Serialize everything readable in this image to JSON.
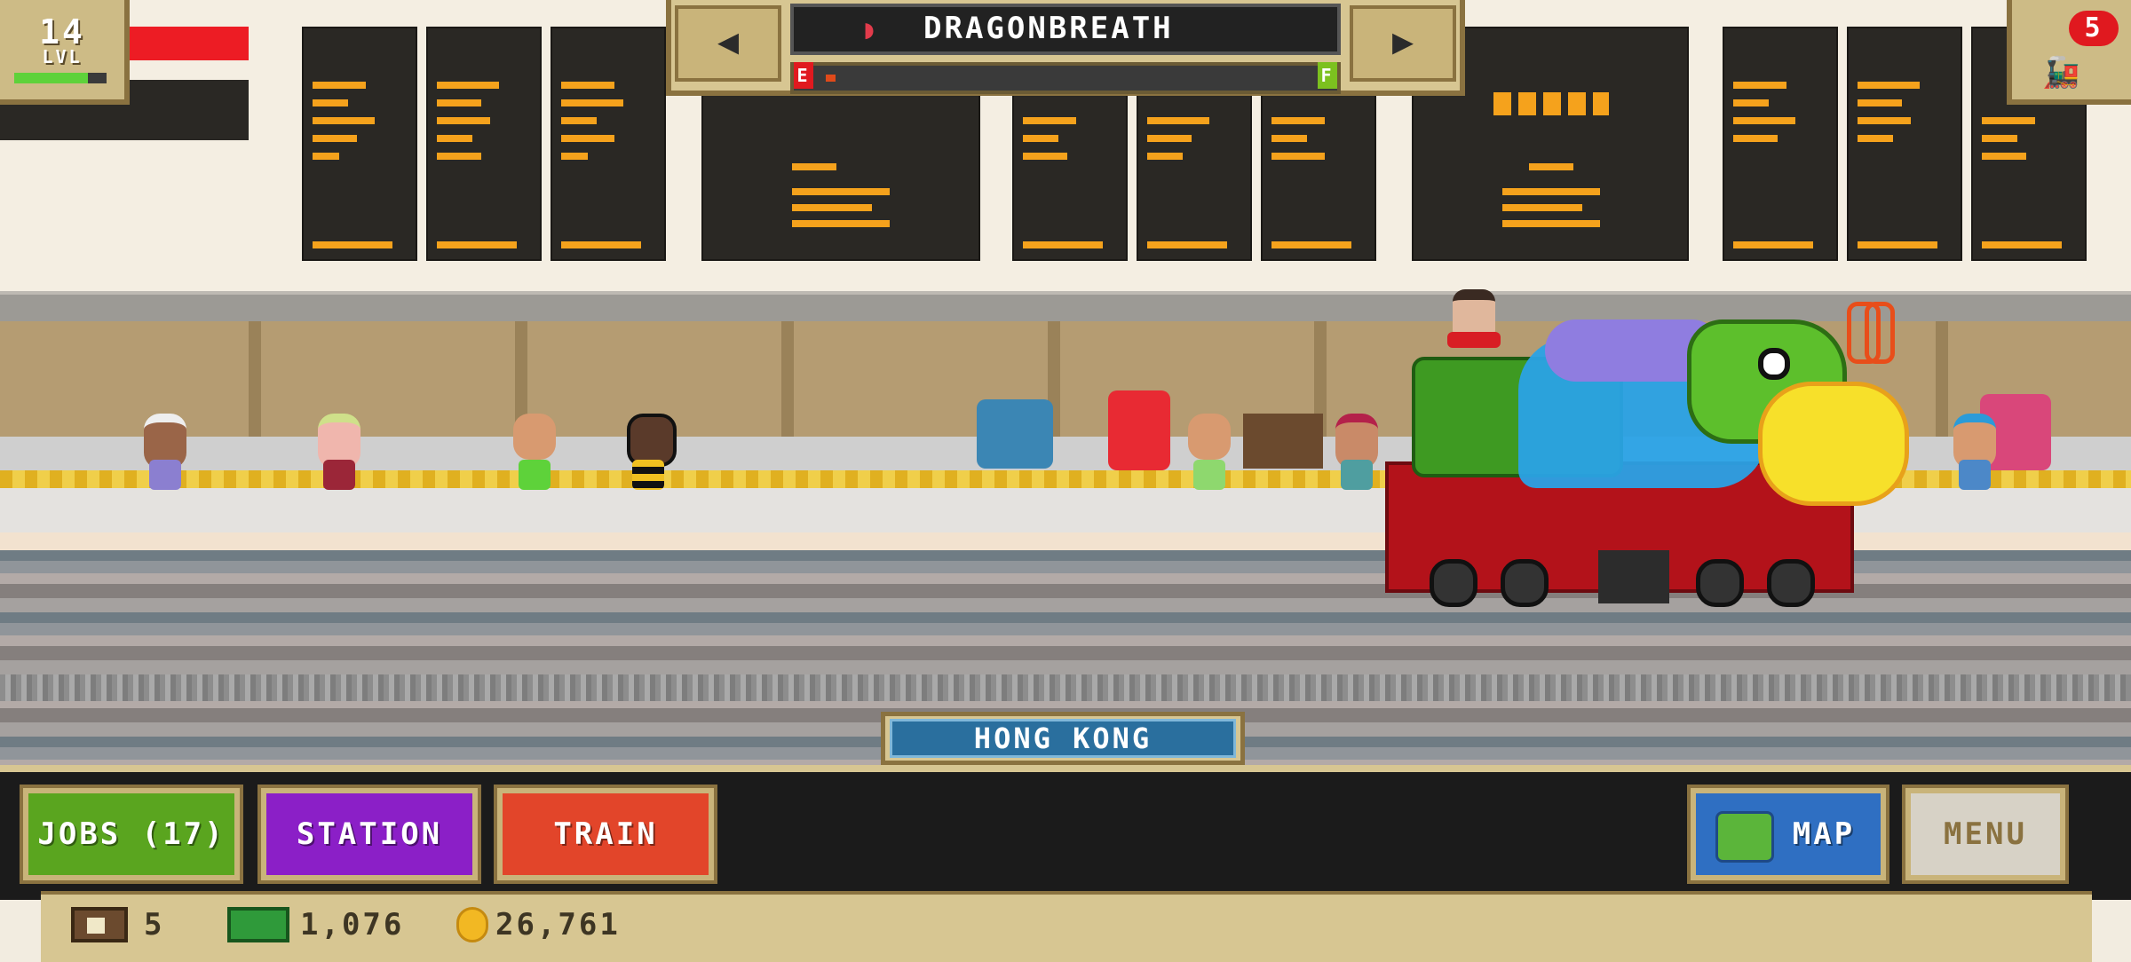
{
  "hud": {
    "level": {
      "number": "14",
      "label": "LVL",
      "progress": 0.8
    },
    "coal": {
      "count": "5"
    }
  },
  "engine_select": {
    "prev_arrow": "◀",
    "next_arrow": "▶",
    "name": "DRAGONBREATH",
    "fuel": {
      "empty_label": "E",
      "full_label": "F",
      "level": 0.02
    }
  },
  "station": {
    "name": "HONG KONG"
  },
  "nav": {
    "jobs_label": "JOBS (17)",
    "station_label": "STATION",
    "train_label": "TRAIN",
    "map_label": "MAP",
    "menu_label": "MENU"
  },
  "stats": {
    "tickets": "5",
    "cash": "1,076",
    "coins": "26,761"
  },
  "colors": {
    "jobs": "#5aa51f",
    "station": "#8b1fc7",
    "train": "#e2452a",
    "map": "#2f6fc2",
    "menu": "#d7d2c6"
  }
}
